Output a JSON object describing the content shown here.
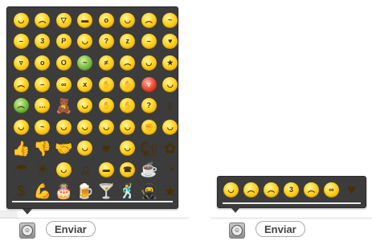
{
  "emoji_panel": {
    "rows": [
      [
        {
          "icon": "smile",
          "g": "◡"
        },
        {
          "icon": "sad",
          "g": "︵"
        },
        {
          "icon": "laugh",
          "g": "▽"
        },
        {
          "icon": "cool",
          "g": "▬"
        },
        {
          "icon": "surprised",
          "g": "o"
        },
        {
          "icon": "wink",
          "g": "◡"
        },
        {
          "icon": "crying",
          "g": "︵"
        },
        {
          "icon": "sweat",
          "g": "~"
        }
      ],
      [
        {
          "icon": "speechless",
          "g": "–"
        },
        {
          "icon": "kiss",
          "g": "3"
        },
        {
          "icon": "tongue-out",
          "g": "P"
        },
        {
          "icon": "blush",
          "g": "◡"
        },
        {
          "icon": "wondering",
          "g": "?"
        },
        {
          "icon": "sleepy",
          "g": "z"
        },
        {
          "icon": "dull",
          "g": "–"
        },
        {
          "icon": "in-love",
          "g": "♥"
        }
      ],
      [
        {
          "icon": "evil-grin",
          "g": "▿"
        },
        {
          "icon": "talking",
          "g": "o"
        },
        {
          "icon": "yawn",
          "g": "O"
        },
        {
          "icon": "puke",
          "g": "~",
          "c": "green"
        },
        {
          "icon": "doh",
          "g": "≠"
        },
        {
          "icon": "angry",
          "g": "︵"
        },
        {
          "icon": "wasnt-me",
          "g": "◡"
        },
        {
          "icon": "party",
          "g": "★"
        }
      ],
      [
        {
          "icon": "worried",
          "g": "︵"
        },
        {
          "icon": "mmm",
          "g": "–"
        },
        {
          "icon": "nerd",
          "g": "∞"
        },
        {
          "icon": "lips-sealed",
          "g": "x"
        },
        {
          "icon": "hi",
          "g": "✋"
        },
        {
          "icon": "facepalm",
          "g": "✋"
        },
        {
          "icon": "devil",
          "g": "▿",
          "c": "red"
        },
        {
          "icon": "angel",
          "g": "◡"
        }
      ],
      [
        {
          "icon": "envy",
          "g": "︵",
          "c": "green"
        },
        {
          "icon": "wait",
          "g": "…"
        },
        {
          "icon": "bear",
          "g": "🧸",
          "c": "glyph"
        },
        {
          "icon": "make-up",
          "g": "◡"
        },
        {
          "icon": "covered-laugh",
          "g": "✋"
        },
        {
          "icon": "clapping",
          "g": "✋"
        },
        {
          "icon": "thinking",
          "g": "?"
        },
        {
          "icon": "bow",
          "g": "♀",
          "c": "glyph"
        }
      ],
      [
        {
          "icon": "rofl",
          "g": "◡"
        },
        {
          "icon": "whew",
          "g": "~"
        },
        {
          "icon": "happy",
          "g": "◡"
        },
        {
          "icon": "smirk",
          "g": "◡"
        },
        {
          "icon": "nod",
          "g": "◡"
        },
        {
          "icon": "shake",
          "g": "◡"
        },
        {
          "icon": "punch",
          "g": "✊"
        },
        {
          "icon": "emo",
          "g": "◡"
        }
      ],
      [
        {
          "icon": "thumbs-up",
          "g": "👍",
          "c": "glyph"
        },
        {
          "icon": "thumbs-down",
          "g": "👎",
          "c": "glyph"
        },
        {
          "icon": "handshake",
          "g": "🤝",
          "c": "glyph"
        },
        {
          "icon": "skype-heart",
          "g": "◡"
        },
        {
          "icon": "heart",
          "g": "♥",
          "c": "glyph"
        },
        {
          "icon": "toivo",
          "g": "◡"
        },
        {
          "icon": "squirrel",
          "g": "🐿",
          "c": "glyph"
        },
        {
          "icon": "flower",
          "g": "✿",
          "c": "glyph"
        }
      ],
      [
        {
          "icon": "rain",
          "g": "☂",
          "c": "glyph"
        },
        {
          "icon": "sun",
          "g": "☀",
          "c": "glyph"
        },
        {
          "icon": "time",
          "g": "◡"
        },
        {
          "icon": "music",
          "g": "♫",
          "c": "glyph"
        },
        {
          "icon": "bandit",
          "g": "▬"
        },
        {
          "icon": "call",
          "g": "☎"
        },
        {
          "icon": "coffee",
          "g": "☕",
          "c": "glyph"
        },
        {
          "icon": "pizza",
          "g": "◔",
          "c": "glyph"
        }
      ],
      [
        {
          "icon": "cash",
          "g": "$",
          "c": "glyph"
        },
        {
          "icon": "muscle",
          "g": "💪",
          "c": "glyph"
        },
        {
          "icon": "cake",
          "g": "🎂",
          "c": "glyph"
        },
        {
          "icon": "beer",
          "g": "🍺",
          "c": "glyph"
        },
        {
          "icon": "drink",
          "g": "🍸",
          "c": "glyph"
        },
        {
          "icon": "dance",
          "g": "🕺",
          "c": "glyph"
        },
        {
          "icon": "ninja",
          "g": "🥷",
          "c": "glyph"
        },
        {
          "icon": "star",
          "g": "★",
          "c": "glyph"
        }
      ]
    ]
  },
  "recent_panel": {
    "items": [
      {
        "icon": "smile",
        "g": "◡"
      },
      {
        "icon": "sad",
        "g": "︵"
      },
      {
        "icon": "crying",
        "g": "︵"
      },
      {
        "icon": "kiss",
        "g": "3"
      },
      {
        "icon": "worried",
        "g": "︵"
      },
      {
        "icon": "nerd",
        "g": "∞"
      },
      {
        "icon": "heart",
        "g": "♥",
        "c": "glyph"
      }
    ]
  },
  "composer_left": {
    "send_label": "Enviar",
    "toggle_icon": "emoticon-toggle-icon"
  },
  "composer_right": {
    "send_label": "Enviar",
    "toggle_icon": "emoticon-toggle-icon"
  },
  "colors": {
    "panel_bg": "#3c3c3c",
    "emoji_yellow": "#ffd21e"
  }
}
